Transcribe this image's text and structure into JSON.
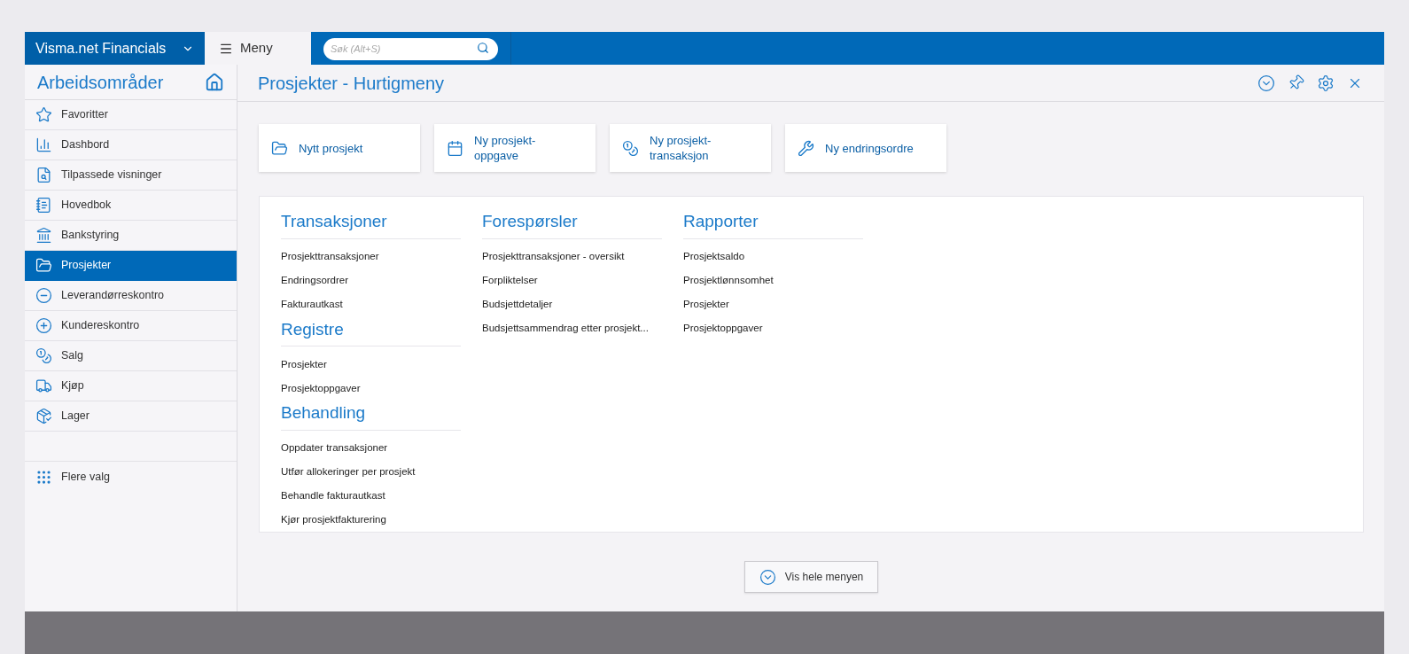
{
  "top_bar": {
    "brand": "Visma.net Financials",
    "menu_tab": {
      "label": "Meny",
      "selected": true
    },
    "search": {
      "placeholder": "Søk (Alt+S)"
    }
  },
  "sidebar": {
    "title": "Arbeidsområder",
    "items": [
      {
        "label": "Favoritter",
        "selected": false
      },
      {
        "label": "Dashbord",
        "selected": false
      },
      {
        "label": "Tilpassede visninger",
        "selected": false
      },
      {
        "label": "Hovedbok",
        "selected": false
      },
      {
        "label": "Bankstyring",
        "selected": false
      },
      {
        "label": "Prosjekter",
        "selected": true
      },
      {
        "label": "Leverandørreskontro",
        "selected": false
      },
      {
        "label": "Kundereskontro",
        "selected": false
      },
      {
        "label": "Salg",
        "selected": false
      },
      {
        "label": "Kjøp",
        "selected": false
      },
      {
        "label": "Lager",
        "selected": false
      }
    ],
    "more": "Flere valg"
  },
  "page": {
    "title": "Prosjekter - Hurtigmeny",
    "quick_actions": [
      "Nytt prosjekt",
      "Ny prosjekt-oppgave",
      "Ny prosjekt-transaksjon",
      "Ny endringsordre"
    ],
    "columns": [
      {
        "sections": [
          {
            "heading": "Transaksjoner",
            "links": [
              "Prosjekttransaksjoner",
              "Endringsordrer",
              "Fakturautkast"
            ]
          },
          {
            "heading": "Registre",
            "links": [
              "Prosjekter",
              "Prosjektoppgaver"
            ]
          },
          {
            "heading": "Behandling",
            "links": [
              "Oppdater transaksjoner",
              "Utfør allokeringer per prosjekt",
              "Behandle fakturautkast",
              "Kjør prosjektfakturering"
            ]
          }
        ]
      },
      {
        "sections": [
          {
            "heading": "Forespørsler",
            "links": [
              "Prosjekttransaksjoner - oversikt",
              "Forpliktelser",
              "Budsjettdetaljer",
              "Budsjettsammendrag etter prosjekt..."
            ]
          }
        ]
      },
      {
        "sections": [
          {
            "heading": "Rapporter",
            "links": [
              "Prosjektsaldo",
              "Prosjektlønnsomhet",
              "Prosjekter",
              "Prosjektoppgaver"
            ]
          }
        ]
      }
    ],
    "show_all_button": "Vis hele menyen"
  }
}
